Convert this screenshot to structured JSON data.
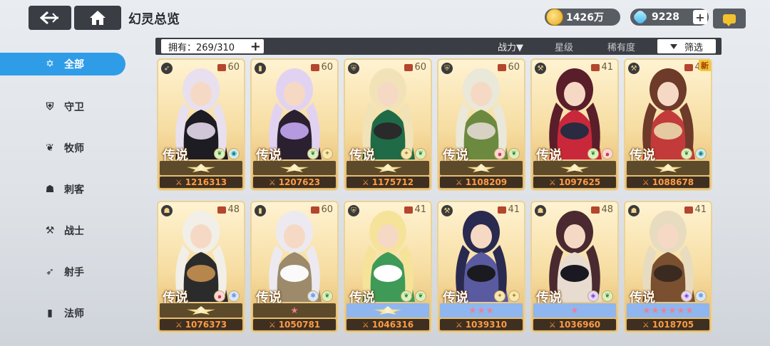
{
  "header": {
    "title": "幻灵总览",
    "gold": "1426万",
    "gems": "9228",
    "back_icon": "back-arrow-icon",
    "home_icon": "home-icon",
    "chat_icon": "chat-icon"
  },
  "filter_bar": {
    "owned_label": "拥有：269/310",
    "sort_power": "战力▼",
    "sort_star": "星级",
    "sort_rarity": "稀有度",
    "filter_label": "筛选"
  },
  "sidebar": {
    "items": [
      {
        "label": "全部",
        "icon": "star-outline-icon"
      },
      {
        "label": "守卫",
        "icon": "shield-icon"
      },
      {
        "label": "牧师",
        "icon": "wings-icon"
      },
      {
        "label": "刺客",
        "icon": "hood-icon"
      },
      {
        "label": "战士",
        "icon": "axe-icon"
      },
      {
        "label": "射手",
        "icon": "bow-icon"
      },
      {
        "label": "法师",
        "icon": "book-icon"
      }
    ],
    "active_index": 0
  },
  "cards": [
    {
      "class_icon": "bow-icon",
      "level": "60",
      "rank": "传说",
      "elements": [
        "leaf",
        "water"
      ],
      "power": "1216313",
      "band": "emblem",
      "new": false,
      "palette": [
        "#e8e0ee",
        "#1c1c22",
        "#d1c5d8"
      ]
    },
    {
      "class_icon": "book-icon",
      "level": "60",
      "rank": "传说",
      "elements": [
        "leaf",
        "wind"
      ],
      "power": "1207623",
      "band": "emblem",
      "new": false,
      "palette": [
        "#e2d2f2",
        "#2a2030",
        "#b59ae0"
      ]
    },
    {
      "class_icon": "shield-icon",
      "level": "60",
      "rank": "传说",
      "elements": [
        "wind",
        "leaf"
      ],
      "power": "1175712",
      "band": "emblem",
      "new": false,
      "palette": [
        "#f1e2b8",
        "#1f6b47",
        "#2a2a2a"
      ]
    },
    {
      "class_icon": "shield-icon",
      "level": "60",
      "rank": "传说",
      "elements": [
        "fire",
        "leaf"
      ],
      "power": "1108209",
      "band": "emblem",
      "new": false,
      "palette": [
        "#eae8d8",
        "#6b8a3f",
        "#d8d2c4"
      ]
    },
    {
      "class_icon": "axe-icon",
      "level": "41",
      "rank": "传说",
      "elements": [
        "leaf",
        "fire",
        "leaf"
      ],
      "power": "1097625",
      "band": "emblem",
      "new": false,
      "palette": [
        "#5a1e2a",
        "#c9283b",
        "#2a2a40"
      ]
    },
    {
      "class_icon": "axe-icon",
      "level": "41",
      "rank": "传说",
      "elements": [
        "leaf",
        "water"
      ],
      "power": "1088678",
      "band": "emblem",
      "new": true,
      "new_label": "新",
      "palette": [
        "#6e3a2a",
        "#c33a3a",
        "#e5c9a0"
      ]
    },
    {
      "class_icon": "hood-icon",
      "level": "48",
      "rank": "传说",
      "elements": [
        "fire",
        "ice"
      ],
      "power": "1076373",
      "band": "emblem",
      "new": false,
      "palette": [
        "#f1efe8",
        "#2b2b2b",
        "#b7864d"
      ]
    },
    {
      "class_icon": "book-icon",
      "level": "60",
      "rank": "传说",
      "elements": [
        "ice",
        "leaf"
      ],
      "power": "1050781",
      "band": "stars",
      "stars": 1,
      "new": false,
      "palette": [
        "#eceaf0",
        "#9c8a6a",
        "#fafafa"
      ]
    },
    {
      "class_icon": "shield-icon",
      "level": "41",
      "rank": "传说",
      "elements": [
        "leaf",
        "leaf"
      ],
      "power": "1046316",
      "band": "emblem-blue",
      "new": false,
      "palette": [
        "#f5e39a",
        "#3f9a57",
        "#ffffff"
      ]
    },
    {
      "class_icon": "axe-icon",
      "level": "41",
      "rank": "传说",
      "elements": [
        "wind",
        "wind"
      ],
      "power": "1039310",
      "band": "stars-blue",
      "stars": 3,
      "new": false,
      "palette": [
        "#2a2a50",
        "#5a5aa0",
        "#1a1a20"
      ]
    },
    {
      "class_icon": "hood-icon",
      "level": "48",
      "rank": "传说",
      "elements": [
        "dark",
        "leaf"
      ],
      "power": "1036960",
      "band": "stars-blue",
      "stars": 1,
      "new": false,
      "palette": [
        "#4a2a30",
        "#e8dcd0",
        "#1a1820"
      ]
    },
    {
      "class_icon": "hood-icon",
      "level": "41",
      "rank": "传说",
      "elements": [
        "dark",
        "ice"
      ],
      "power": "1018705",
      "band": "stars-blue",
      "stars": 6,
      "new": false,
      "palette": [
        "#e8dcc0",
        "#7a5030",
        "#3a2a20"
      ]
    }
  ]
}
